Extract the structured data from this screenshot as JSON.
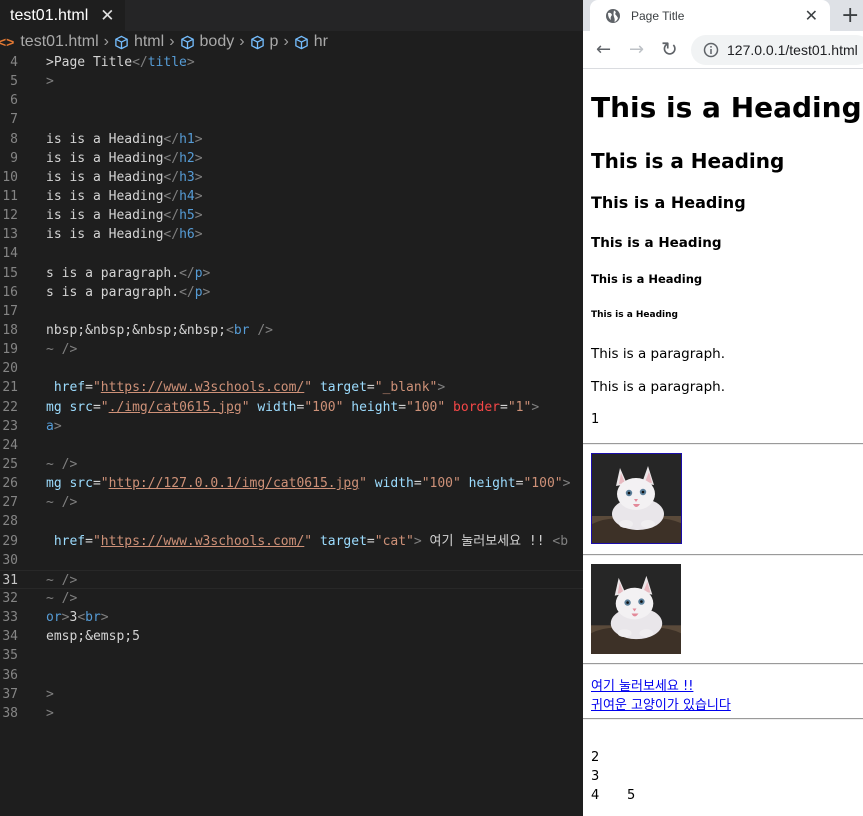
{
  "editor": {
    "tab_title": "test01.html",
    "tab_close": "✕",
    "breadcrumb": [
      "test01.html",
      "html",
      "body",
      "p",
      "hr"
    ],
    "lines": [
      {
        "n": "4",
        "t": [
          [
            "tx",
            ">Page Title"
          ],
          [
            "tg",
            "</"
          ],
          [
            "tn",
            "title"
          ],
          [
            "tg",
            ">"
          ]
        ]
      },
      {
        "n": "5",
        "t": [
          [
            "tg",
            ">"
          ]
        ]
      },
      {
        "n": "6",
        "t": []
      },
      {
        "n": "7",
        "t": []
      },
      {
        "n": "8",
        "t": [
          [
            "tx",
            "is is a Heading"
          ],
          [
            "tg",
            "</"
          ],
          [
            "tn",
            "h1"
          ],
          [
            "tg",
            ">"
          ]
        ]
      },
      {
        "n": "9",
        "t": [
          [
            "tx",
            "is is a Heading"
          ],
          [
            "tg",
            "</"
          ],
          [
            "tn",
            "h2"
          ],
          [
            "tg",
            ">"
          ]
        ]
      },
      {
        "n": "10",
        "t": [
          [
            "tx",
            "is is a Heading"
          ],
          [
            "tg",
            "</"
          ],
          [
            "tn",
            "h3"
          ],
          [
            "tg",
            ">"
          ]
        ]
      },
      {
        "n": "11",
        "t": [
          [
            "tx",
            "is is a Heading"
          ],
          [
            "tg",
            "</"
          ],
          [
            "tn",
            "h4"
          ],
          [
            "tg",
            ">"
          ]
        ]
      },
      {
        "n": "12",
        "t": [
          [
            "tx",
            "is is a Heading"
          ],
          [
            "tg",
            "</"
          ],
          [
            "tn",
            "h5"
          ],
          [
            "tg",
            ">"
          ]
        ]
      },
      {
        "n": "13",
        "t": [
          [
            "tx",
            "is is a Heading"
          ],
          [
            "tg",
            "</"
          ],
          [
            "tn",
            "h6"
          ],
          [
            "tg",
            ">"
          ]
        ]
      },
      {
        "n": "14",
        "t": []
      },
      {
        "n": "15",
        "t": [
          [
            "tx",
            "s is a paragraph."
          ],
          [
            "tg",
            "</"
          ],
          [
            "tn",
            "p"
          ],
          [
            "tg",
            ">"
          ]
        ]
      },
      {
        "n": "16",
        "t": [
          [
            "tx",
            "s is a paragraph."
          ],
          [
            "tg",
            "</"
          ],
          [
            "tn",
            "p"
          ],
          [
            "tg",
            ">"
          ]
        ]
      },
      {
        "n": "17",
        "t": []
      },
      {
        "n": "18",
        "t": [
          [
            "tx",
            "nbsp;&nbsp;&nbsp;&nbsp;"
          ],
          [
            "tg",
            "<"
          ],
          [
            "tn",
            "br"
          ],
          [
            "tg",
            " />"
          ]
        ]
      },
      {
        "n": "19",
        "t": [
          [
            "tg",
            "~ />"
          ]
        ]
      },
      {
        "n": "20",
        "t": []
      },
      {
        "n": "21",
        "t": [
          [
            "tx",
            " "
          ],
          [
            "an",
            "href"
          ],
          [
            "tx",
            "="
          ],
          [
            "av",
            "\""
          ],
          [
            "lk",
            "https://www.w3schools.com/"
          ],
          [
            "av",
            "\""
          ],
          [
            "tx",
            " "
          ],
          [
            "an",
            "target"
          ],
          [
            "tx",
            "="
          ],
          [
            "av",
            "\"_blank\""
          ],
          [
            "tg",
            ">"
          ]
        ]
      },
      {
        "n": "22",
        "t": [
          [
            "an",
            "mg src"
          ],
          [
            "tx",
            "="
          ],
          [
            "av",
            "\""
          ],
          [
            "lk",
            "./img/cat0615.jpg"
          ],
          [
            "av",
            "\""
          ],
          [
            "tx",
            " "
          ],
          [
            "an",
            "width"
          ],
          [
            "tx",
            "="
          ],
          [
            "av",
            "\"100\""
          ],
          [
            "tx",
            " "
          ],
          [
            "an",
            "height"
          ],
          [
            "tx",
            "="
          ],
          [
            "av",
            "\"100\""
          ],
          [
            "tx",
            " "
          ],
          [
            "ar",
            "border"
          ],
          [
            "tx",
            "="
          ],
          [
            "av",
            "\"1\""
          ],
          [
            "tg",
            ">"
          ]
        ]
      },
      {
        "n": "23",
        "t": [
          [
            "tn",
            "a"
          ],
          [
            "tg",
            ">"
          ]
        ]
      },
      {
        "n": "24",
        "t": []
      },
      {
        "n": "25",
        "t": [
          [
            "tg",
            "~ />"
          ]
        ]
      },
      {
        "n": "26",
        "t": [
          [
            "an",
            "mg src"
          ],
          [
            "tx",
            "="
          ],
          [
            "av",
            "\""
          ],
          [
            "lk",
            "http://127.0.0.1/img/cat0615.jpg"
          ],
          [
            "av",
            "\""
          ],
          [
            "tx",
            " "
          ],
          [
            "an",
            "width"
          ],
          [
            "tx",
            "="
          ],
          [
            "av",
            "\"100\""
          ],
          [
            "tx",
            " "
          ],
          [
            "an",
            "height"
          ],
          [
            "tx",
            "="
          ],
          [
            "av",
            "\"100\""
          ],
          [
            "tg",
            ">"
          ]
        ]
      },
      {
        "n": "27",
        "t": [
          [
            "tg",
            "~ />"
          ]
        ]
      },
      {
        "n": "28",
        "t": []
      },
      {
        "n": "29",
        "t": [
          [
            "tx",
            " "
          ],
          [
            "an",
            "href"
          ],
          [
            "tx",
            "="
          ],
          [
            "av",
            "\""
          ],
          [
            "lk",
            "https://www.w3schools.com/"
          ],
          [
            "av",
            "\""
          ],
          [
            "tx",
            " "
          ],
          [
            "an",
            "target"
          ],
          [
            "tx",
            "="
          ],
          [
            "av",
            "\"cat\""
          ],
          [
            "tg",
            ">"
          ],
          [
            "tx",
            " 여기 눌러보세요 !! "
          ],
          [
            "tg",
            "<b"
          ]
        ]
      },
      {
        "n": "30",
        "t": []
      },
      {
        "n": "31",
        "t": [
          [
            "tg",
            "~ />"
          ]
        ],
        "current": true
      },
      {
        "n": "32",
        "t": [
          [
            "tg",
            "~ />"
          ]
        ]
      },
      {
        "n": "33",
        "t": [
          [
            "tn",
            "or"
          ],
          [
            "tg",
            ">"
          ],
          [
            "tx",
            "3"
          ],
          [
            "tg",
            "<"
          ],
          [
            "tn",
            "br"
          ],
          [
            "tg",
            ">"
          ]
        ]
      },
      {
        "n": "34",
        "t": [
          [
            "tx",
            "emsp;&emsp;5"
          ]
        ]
      },
      {
        "n": "35",
        "t": []
      },
      {
        "n": "36",
        "t": []
      },
      {
        "n": "37",
        "t": [
          [
            "tg",
            ">"
          ]
        ]
      },
      {
        "n": "38",
        "t": [
          [
            "tg",
            ">"
          ]
        ]
      }
    ]
  },
  "browser": {
    "tab_title": "Page Title",
    "tab_close": "✕",
    "new_tab": "+",
    "back": "←",
    "forward": "→",
    "reload": "↻",
    "address": "127.0.0.1/test01.html",
    "headings": [
      "This is a Heading",
      "This is a Heading",
      "This is a Heading",
      "This is a Heading",
      "This is a Heading",
      "This is a Heading"
    ],
    "paragraphs": [
      "This is a paragraph.",
      "This is a paragraph."
    ],
    "text_1": "1",
    "link_1": "여기 눌러보세요 !!",
    "link_2": "귀여운 고양이가 있습니다",
    "text_2": "2",
    "text_3": "3",
    "text_4": "4",
    "text_5": "5"
  }
}
